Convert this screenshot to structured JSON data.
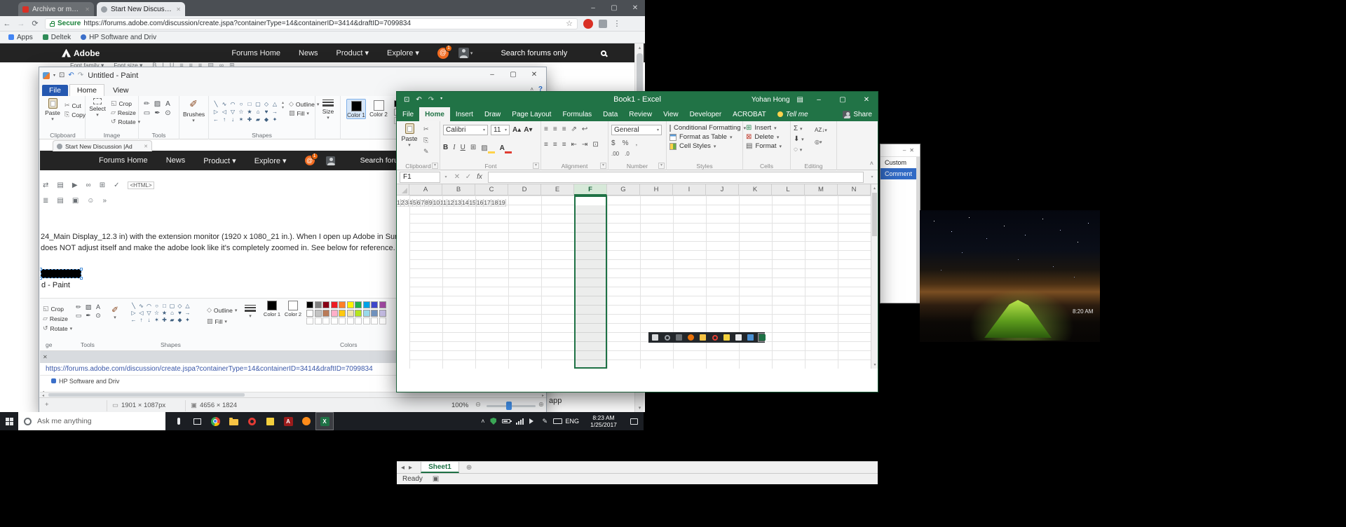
{
  "icons": {
    "minimize": "–",
    "maximize": "▢",
    "close": "✕",
    "dropdown": "▾",
    "up": "▴",
    "down": "▾",
    "left": "◂",
    "right": "▸",
    "back": "←",
    "forward": "→",
    "reload": "⟳",
    "star": "☆",
    "menu": "⋮",
    "save": "⊡",
    "undo": "↶",
    "redo": "↷",
    "help": "?",
    "collapse": "˄",
    "cut": "✂",
    "copy": "⎘",
    "bold": "B",
    "italic": "I",
    "underline": "U",
    "grow": "A▴",
    "shrink": "A▾",
    "borders": "⊞",
    "fill_color": "▨",
    "font_color": "A",
    "align": "≡",
    "orientation": "⇗",
    "wrap": "↩",
    "indent_left": "⇤",
    "indent_right": "⇥",
    "merge": "⊡",
    "dollar": "$",
    "percent": "%",
    "comma": ",",
    "dec0": ".00",
    "dec1": ".0",
    "sum": "Σ",
    "filldown": "⬇",
    "clear": "◌",
    "sort": "AZ↓",
    "find": "◎",
    "ins": "⊞",
    "del": "⊠",
    "fmt": "▤",
    "fx": "fx",
    "check": "✓",
    "zoom_out": "⊖",
    "zoom_in": "⊕",
    "crosshair": "+",
    "sel_box": "▭",
    "img_box": "▣",
    "crop_icon": "◱",
    "resize_icon": "▱",
    "rotate_icon": "↺",
    "outline_icon": "◇",
    "fill_icon": "▨",
    "plus_circle": "⊕",
    "macro": "▣",
    "brush": "✐",
    "at": "@",
    "pen": "✎"
  },
  "chrome": {
    "tabs": [
      {
        "title": "Archive or mute Gmail m"
      },
      {
        "title": "Start New Discussion |Ad"
      }
    ],
    "address": {
      "secure": "Secure",
      "url": "https://forums.adobe.com/discussion/create.jspa?containerType=14&containerID=3414&draftID=7099834"
    },
    "bookmarks": {
      "apps": "Apps",
      "b1": "Deltek",
      "b2": "HP Software and Driv"
    },
    "page_fragment_text": "app",
    "editor_icons": [
      {
        "name": "bold-icon",
        "glyph": "B"
      },
      {
        "name": "italic-icon",
        "glyph": "I"
      },
      {
        "name": "underline-icon",
        "glyph": "U"
      },
      {
        "name": "align-left-icon",
        "glyph": "≡"
      },
      {
        "name": "align-center-icon",
        "glyph": "≡"
      },
      {
        "name": "align-right-icon",
        "glyph": "≡"
      },
      {
        "name": "list-icon",
        "glyph": "▤"
      },
      {
        "name": "link-icon",
        "glyph": "∞"
      },
      {
        "name": "table-icon",
        "glyph": "⊞"
      }
    ]
  },
  "adobe": {
    "brand": "Adobe",
    "nav": [
      {
        "label": "Forums Home"
      },
      {
        "label": "News"
      },
      {
        "label": "Product",
        "dropdown": true
      },
      {
        "label": "Explore",
        "dropdown": true
      }
    ],
    "badge": "1",
    "search_label": "Search forums only",
    "editor": {
      "font_family": "Font family",
      "font_size": "Font size"
    }
  },
  "paint": {
    "title": "Untitled - Paint",
    "tabs": {
      "file": "File",
      "home": "Home",
      "view": "View"
    },
    "ribbon": {
      "paste": "Paste",
      "cut": "Cut",
      "copy": "Copy",
      "clipboard": "Clipboard",
      "select": "Select",
      "crop": "Crop",
      "resize": "Resize",
      "rotate": "Rotate",
      "image": "Image",
      "tools": "Tools",
      "brushes": "Brushes",
      "shapes": "Shapes",
      "outline": "Outline",
      "fill": "Fill",
      "size": "Size",
      "color1": "Color 1",
      "color2": "Color 2",
      "colors": "Colors"
    },
    "tool_icons": [
      {
        "name": "pencil-icon",
        "glyph": "✏"
      },
      {
        "name": "fill-bucket-icon",
        "glyph": "▨"
      },
      {
        "name": "text-tool-icon",
        "glyph": "A"
      },
      {
        "name": "eraser-icon",
        "glyph": "▭"
      },
      {
        "name": "color-picker-icon",
        "glyph": "✒"
      },
      {
        "name": "magnifier-icon",
        "glyph": "⊙"
      }
    ],
    "shape_glyphs": [
      "╲",
      "∿",
      "◠",
      "○",
      "□",
      "▢",
      "◇",
      "△",
      "▷",
      "◁",
      "▽",
      "☆",
      "★",
      "⌂",
      "♥",
      "→",
      "←",
      "↑",
      "↓",
      "✶",
      "✚",
      "▰",
      "◆",
      "✦"
    ],
    "palette_row1": [
      "#000000",
      "#7f7f7f",
      "#880015",
      "#ed1c24",
      "#ff7f27",
      "#fff200",
      "#22b14c",
      "#00a2e8",
      "#3f48cc",
      "#a349a4"
    ],
    "palette_row2": [
      "#ffffff",
      "#c3c3c3",
      "#b97a57",
      "#ffaec9",
      "#ffc90e",
      "#efe4b0",
      "#b5e61d",
      "#99d9ea",
      "#7092be",
      "#c8bfe7"
    ],
    "status": {
      "selection_size": "1901 × 1087px",
      "image_size": "4656 × 1824",
      "zoom": "100%"
    }
  },
  "canvas": {
    "body_line1": "24_Main Display_12.3 in) with the extension monitor (1920 x 1080_21 in.). When I open up Adobe in Surface monitor and",
    "body_line2": "does NOT adjust itself and make the adobe look like it's completely zoomed in. See below for reference. The confusion I",
    "html_label": "<HTML>",
    "toolbar_row1": [
      {
        "name": "swap-icon",
        "glyph": "⇄"
      },
      {
        "name": "styles-icon",
        "glyph": "▤"
      },
      {
        "name": "video-icon",
        "glyph": "▶"
      },
      {
        "name": "link-icon",
        "glyph": "∞"
      },
      {
        "name": "table-icon",
        "glyph": "⊞"
      },
      {
        "name": "spellcheck-icon",
        "glyph": "✓"
      }
    ],
    "toolbar_row2": [
      {
        "name": "indent-icon",
        "glyph": "≣"
      },
      {
        "name": "list-icon",
        "glyph": "▤"
      },
      {
        "name": "image-icon",
        "glyph": "▣"
      },
      {
        "name": "emoji-icon",
        "glyph": "☺"
      },
      {
        "name": "more-icon",
        "glyph": "»"
      }
    ],
    "paint_fragment_title": "d - Paint",
    "nested_labels": {
      "image": "ge",
      "tools": "Tools",
      "shapes": "Shapes",
      "colors": "Colors"
    },
    "chrome_fragment": {
      "tab_title": "Start New Discussion |Ad",
      "url": "https://forums.adobe.com/discussion/create.jspa?containerType=14&containerID=3414&draftID=7099834",
      "bookmark": "HP Software and Driv"
    }
  },
  "excel": {
    "title": "Book1 - Excel",
    "user": "Yohan Hong",
    "share": "Share",
    "tell_me": "Tell me",
    "tabs": [
      {
        "label": "File",
        "file": true
      },
      {
        "label": "Home",
        "selected": true
      },
      {
        "label": "Insert"
      },
      {
        "label": "Draw"
      },
      {
        "label": "Page Layout"
      },
      {
        "label": "Formulas"
      },
      {
        "label": "Data"
      },
      {
        "label": "Review"
      },
      {
        "label": "View"
      },
      {
        "label": "Developer"
      },
      {
        "label": "ACROBAT"
      }
    ],
    "ribbon": {
      "paste": "Paste",
      "clipboard": "Clipboard",
      "font_name": "Calibri",
      "font_size": "11",
      "font": "Font",
      "alignment": "Alignment",
      "number_format": "General",
      "number": "Number",
      "conditional_formatting": "Conditional Formatting",
      "format_as_table": "Format as Table",
      "cell_styles": "Cell Styles",
      "styles": "Styles",
      "insert": "Insert",
      "delete": "Delete",
      "format": "Format",
      "cells": "Cells",
      "editing": "Editing"
    },
    "name_box": "F1",
    "columns": [
      "A",
      "B",
      "C",
      "D",
      "E",
      "F",
      "G",
      "H",
      "I",
      "J",
      "K",
      "L",
      "M",
      "N"
    ],
    "selected_column": "F",
    "rows": [
      "1",
      "2",
      "3",
      "4",
      "5",
      "6",
      "7",
      "8",
      "9",
      "10",
      "11",
      "12",
      "13",
      "14",
      "15",
      "16",
      "17",
      "18",
      "19"
    ],
    "sheet_tab": "Sheet1",
    "status_ready": "Ready",
    "embedded_strip_icons": [
      {
        "name": "windows-logo-icon",
        "shape": "win",
        "color": "#d8dadc"
      },
      {
        "name": "cortana-icon",
        "shape": "ring",
        "color": "#9aa0a6"
      },
      {
        "name": "task-view-icon",
        "shape": "square",
        "color": "#6a6f73"
      },
      {
        "name": "firefox-icon",
        "shape": "circle",
        "color": "#e8710a"
      },
      {
        "name": "file-explorer-icon",
        "shape": "square",
        "color": "#f6c344"
      },
      {
        "name": "opera-icon",
        "shape": "ring",
        "color": "#e34134"
      },
      {
        "name": "sticky-notes-icon",
        "shape": "square",
        "color": "#f3d23e"
      },
      {
        "name": "document-icon",
        "shape": "square",
        "color": "#e8eaed"
      },
      {
        "name": "photos-icon",
        "shape": "square",
        "color": "#4a90d2"
      },
      {
        "name": "excel-icon",
        "shape": "square",
        "color": "#1e7145",
        "active": true
      }
    ]
  },
  "side_panel": {
    "item_custom": "Custom",
    "item_comment": "Comment"
  },
  "photo": {
    "clock": "8:20 AM"
  },
  "taskbar": {
    "search_placeholder": "Ask me anything",
    "language": "ENG",
    "time": "8:23 AM",
    "date": "1/25/2017",
    "app_icons": [
      {
        "name": "microphone-icon",
        "shape": "pill",
        "color": "#e8eaed"
      },
      {
        "name": "task-view-icon",
        "shape": "frame",
        "color": "#e8eaed"
      },
      {
        "name": "chrome-icon",
        "shape": "chrome",
        "color": "#4a90d2"
      },
      {
        "name": "file-explorer-icon",
        "shape": "folder",
        "color": "#f6c344"
      },
      {
        "name": "opera-icon",
        "shape": "ring",
        "color": "#e23b34"
      },
      {
        "name": "sticky-notes-icon",
        "shape": "square",
        "color": "#f3cf3e"
      },
      {
        "name": "acrobat-icon",
        "shape": "letter",
        "color": "#9b1c1c",
        "letter": "A"
      },
      {
        "name": "firefox-icon",
        "shape": "circle",
        "color": "#ff8c1a"
      },
      {
        "name": "excel-icon",
        "shape": "letter",
        "color": "#1e7145",
        "letter": "X",
        "active": true
      }
    ],
    "tray_icons": [
      {
        "name": "hidden-icons-chevron",
        "shape": "text",
        "glyph": "˄"
      },
      {
        "name": "defender-icon",
        "shape": "shield",
        "color": "#3aa655"
      },
      {
        "name": "battery-icon",
        "shape": "battery"
      },
      {
        "name": "network-icon",
        "shape": "bars"
      },
      {
        "name": "volume-icon",
        "shape": "tri"
      },
      {
        "name": "pen-icon",
        "shape": "text",
        "glyph": "✎"
      },
      {
        "name": "keyboard-icon",
        "shape": "kbd"
      }
    ]
  }
}
